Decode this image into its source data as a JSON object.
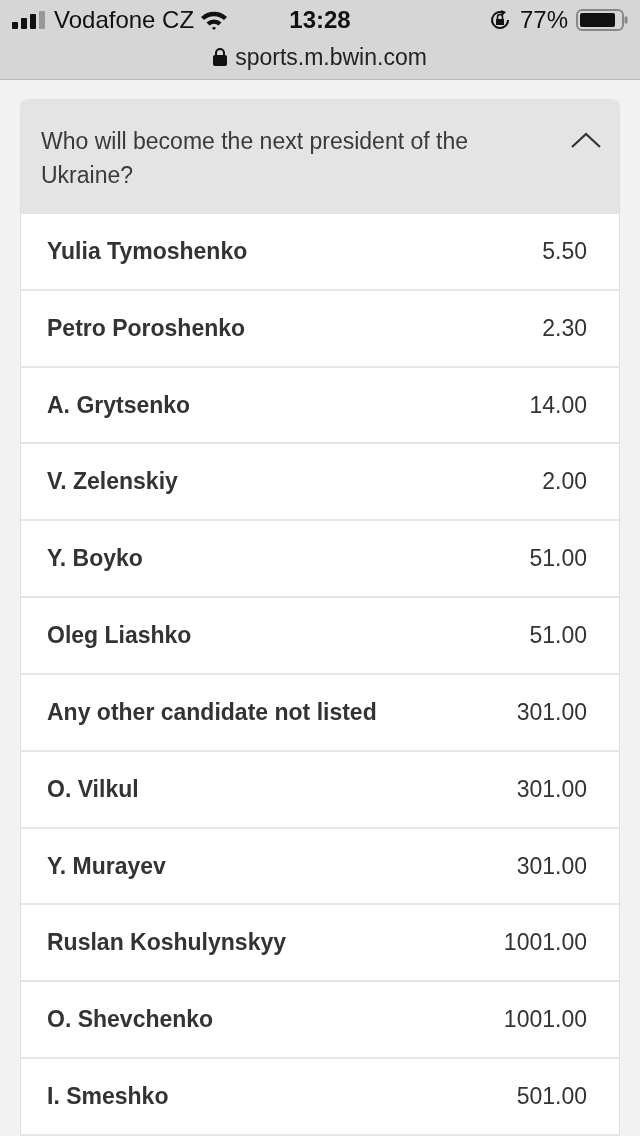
{
  "status_bar": {
    "carrier": "Vodafone CZ",
    "time": "13:28",
    "battery": "77%"
  },
  "address_bar": {
    "url": "sports.m.bwin.com"
  },
  "market": {
    "title": "Who will become the next president of the Ukraine?",
    "expanded": true,
    "options": [
      {
        "name": "Yulia Tymoshenko",
        "odds": "5.50"
      },
      {
        "name": "Petro Poroshenko",
        "odds": "2.30"
      },
      {
        "name": "A. Grytsenko",
        "odds": "14.00"
      },
      {
        "name": "V. Zelenskiy",
        "odds": "2.00"
      },
      {
        "name": "Y. Boyko",
        "odds": "51.00"
      },
      {
        "name": "Oleg Liashko",
        "odds": "51.00"
      },
      {
        "name": "Any other candidate not listed",
        "odds": "301.00"
      },
      {
        "name": "O. Vilkul",
        "odds": "301.00"
      },
      {
        "name": "Y. Murayev",
        "odds": "301.00"
      },
      {
        "name": "Ruslan Koshulynskyy",
        "odds": "1001.00"
      },
      {
        "name": "O. Shevchenko",
        "odds": "1001.00"
      },
      {
        "name": "I. Smeshko",
        "odds": "501.00"
      }
    ]
  }
}
